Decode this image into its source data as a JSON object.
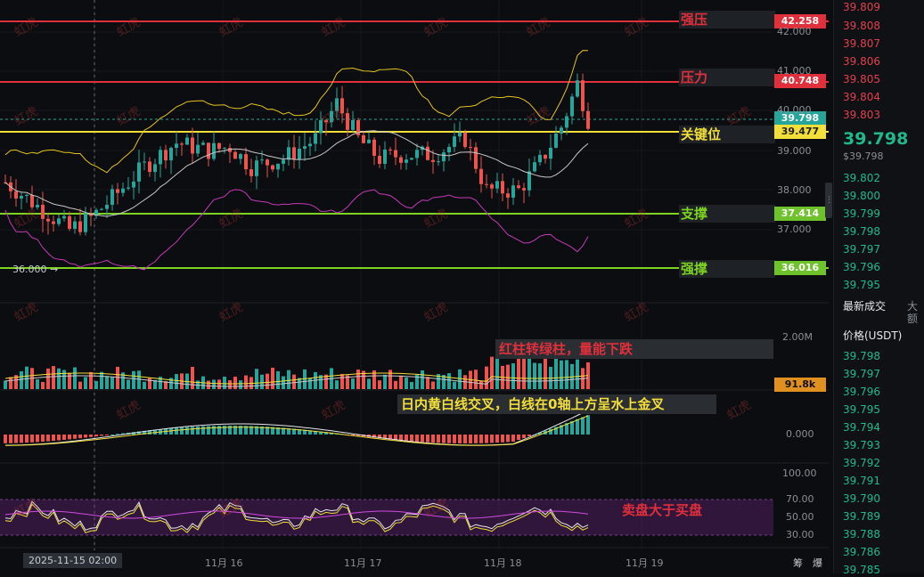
{
  "levels": [
    {
      "label": "强压",
      "price": "42.258",
      "color": "#e0303c"
    },
    {
      "label": "压力",
      "price": "40.748",
      "color": "#e0303c"
    },
    {
      "label": "关键位",
      "price": "39.477",
      "color": "#f2df3a"
    },
    {
      "label": "支撑",
      "price": "37.414",
      "color": "#7ed321"
    },
    {
      "label": "强撑",
      "price": "36.016",
      "color": "#7ed321"
    }
  ],
  "current_price": "39.798",
  "low_marker": "36.000",
  "price_axis": [
    "42.000",
    "41.000",
    "40.000",
    "39.000",
    "38.000",
    "37.000"
  ],
  "volume_axis": {
    "top": "2.00M",
    "current": "91.8k"
  },
  "macd_axis": {
    "zero": "0.000"
  },
  "rsi_axis": [
    "100.00",
    "70.00",
    "50.00",
    "30.00"
  ],
  "x_axis": {
    "highlight": "2025-11-15 02:00",
    "ticks": [
      "11月 16",
      "11月 17",
      "11月 18",
      "11月 19"
    ],
    "right_buttons": [
      "筹",
      "爆"
    ]
  },
  "notes": {
    "volume": "红柱转绿柱，量能下跌",
    "macd": "日内黄白线交叉，白线在0轴上方呈水上金叉",
    "rsi": "卖盘大于买盘"
  },
  "watermark": "虹虎",
  "order_book": {
    "asks": [
      "39.809",
      "39.808",
      "39.807",
      "39.806",
      "39.805",
      "39.804",
      "39.803"
    ],
    "last_price": "39.798",
    "last_price_usd": "$39.798",
    "bids": [
      "39.802",
      "39.800",
      "39.799",
      "39.798",
      "39.797",
      "39.796",
      "39.795"
    ],
    "trades_title": "最新成交",
    "trades_tab2": "大额",
    "price_header": "价格(USDT)",
    "trades": [
      {
        "p": "39.798",
        "c": "green"
      },
      {
        "p": "39.797",
        "c": "green"
      },
      {
        "p": "39.796",
        "c": "green"
      },
      {
        "p": "39.795",
        "c": "green"
      },
      {
        "p": "39.794",
        "c": "green"
      },
      {
        "p": "39.793",
        "c": "green"
      },
      {
        "p": "39.792",
        "c": "green"
      },
      {
        "p": "39.791",
        "c": "green"
      },
      {
        "p": "39.790",
        "c": "green"
      },
      {
        "p": "39.789",
        "c": "green"
      },
      {
        "p": "39.788",
        "c": "green"
      },
      {
        "p": "39.786",
        "c": "green"
      },
      {
        "p": "39.785",
        "c": "green"
      }
    ]
  },
  "colors": {
    "up": "#26a69a",
    "down": "#ef5350",
    "bb_mid": "#c8c8c8",
    "bb_up": "#e6c31e",
    "bb_low": "#c639b9"
  }
}
